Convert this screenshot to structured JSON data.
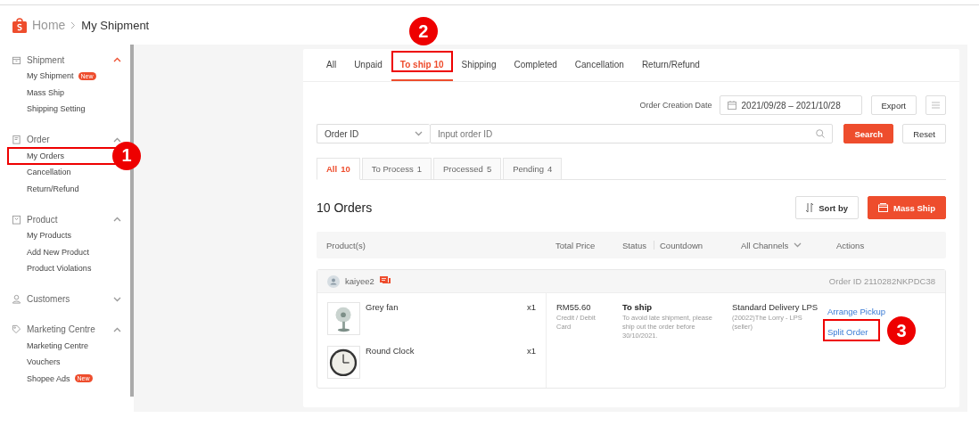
{
  "breadcrumb": {
    "home": "Home",
    "current": "My Shipment"
  },
  "sidebar": {
    "groups": [
      {
        "title": "Shipment",
        "expanded": true,
        "active": true,
        "items": [
          {
            "label": "My Shipment",
            "badge": "New"
          },
          {
            "label": "Mass Ship"
          },
          {
            "label": "Shipping Setting"
          }
        ]
      },
      {
        "title": "Order",
        "expanded": true,
        "active": false,
        "items": [
          {
            "label": "My Orders",
            "callout": "1"
          },
          {
            "label": "Cancellation"
          },
          {
            "label": "Return/Refund"
          }
        ]
      },
      {
        "title": "Product",
        "expanded": true,
        "active": false,
        "items": [
          {
            "label": "My Products"
          },
          {
            "label": "Add New Product"
          },
          {
            "label": "Product Violations"
          }
        ]
      },
      {
        "title": "Customers",
        "expanded": false,
        "active": false
      },
      {
        "title": "Marketing Centre",
        "expanded": true,
        "active": false,
        "items": [
          {
            "label": "Marketing Centre"
          },
          {
            "label": "Vouchers"
          },
          {
            "label": "Shopee Ads",
            "badge": "New"
          }
        ]
      }
    ]
  },
  "status_tabs": [
    {
      "label": "All",
      "selected": false
    },
    {
      "label": "Unpaid",
      "selected": false
    },
    {
      "label": "To ship 10",
      "selected": true,
      "callout": "2"
    },
    {
      "label": "Shipping",
      "selected": false
    },
    {
      "label": "Completed",
      "selected": false
    },
    {
      "label": "Cancellation",
      "selected": false
    },
    {
      "label": "Return/Refund",
      "selected": false
    }
  ],
  "filters": {
    "date_label": "Order Creation Date",
    "date_range": "2021/09/28 – 2021/10/28",
    "export_button": "Export",
    "search_type": "Order ID",
    "search_placeholder": "Input order ID",
    "search_button": "Search",
    "reset_button": "Reset"
  },
  "sub_tabs": [
    {
      "label": "All",
      "count": "10",
      "selected": true
    },
    {
      "label": "To Process",
      "count": "1",
      "selected": false
    },
    {
      "label": "Processed",
      "count": "5",
      "selected": false
    },
    {
      "label": "Pending",
      "count": "4",
      "selected": false
    }
  ],
  "orders_title": "10 Orders",
  "sort_button": "Sort by",
  "mass_ship_button": "Mass Ship",
  "table": {
    "columns": [
      {
        "label": "Product(s)",
        "kind": "plain"
      },
      {
        "label": "Total Price",
        "kind": "plain"
      },
      {
        "label": "Status",
        "kind": "split"
      },
      {
        "label": "Countdown",
        "kind": "plain"
      },
      {
        "label": "All Channels",
        "kind": "dropdown"
      },
      {
        "label": "Actions",
        "kind": "plain"
      }
    ]
  },
  "order": {
    "buyer": "kaiyee2",
    "order_id": "Order ID 2110282NKPDC38",
    "products": [
      {
        "name": "Grey fan",
        "quantity": "x1",
        "kind": "picture"
      },
      {
        "name": "Round Clock",
        "quantity": "x1",
        "kind": "picture"
      }
    ],
    "total": "RM55.60",
    "payment": "Credit / Debit Card",
    "status": "To ship",
    "status_note": "To avoid late shipment, please ship out the order before 30/10/2021.",
    "shipping": "Standard Delivery LPS",
    "carrier": "(20022)The Lorry - LPS (seller)",
    "actions": [
      {
        "label": "Arrange Pickup"
      },
      {
        "label": "Split Order",
        "callout": "3"
      }
    ]
  }
}
